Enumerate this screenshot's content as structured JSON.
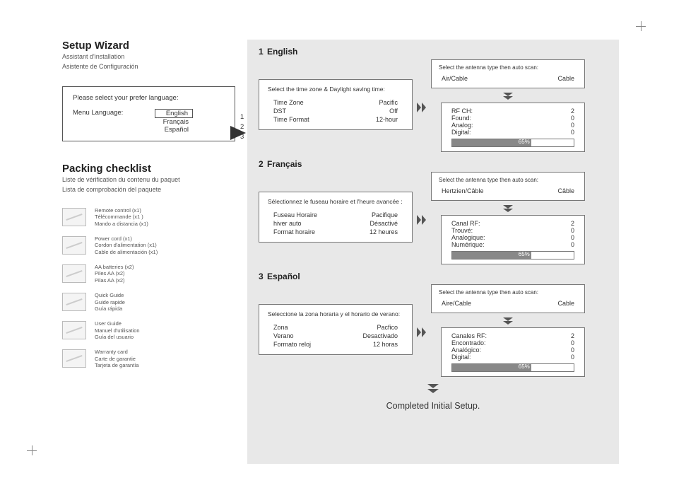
{
  "setup": {
    "title": "Setup Wizard",
    "sub1": "Assistant d'installation",
    "sub2": "Asistente de Configuración",
    "lang_prompt": "Please select your prefer language:",
    "menu_label": "Menu Language:",
    "opt_en": "English",
    "opt_fr": "Français",
    "opt_es": "Español",
    "n1": "1",
    "n2": "2",
    "n3": "3"
  },
  "packing": {
    "title": "Packing checklist",
    "sub1": "Liste de vérification du contenu du paquet",
    "sub2": "Lista de comprobación del paquete",
    "items": [
      {
        "l1": "Remote control (x1)",
        "l2": "Télécommande (x1 )",
        "l3": "Mando a distancia (x1)"
      },
      {
        "l1": "Power cord (x1)",
        "l2": "Cordon d'alimentation (x1)",
        "l3": "Cable de alimentación (x1)"
      },
      {
        "l1": "AA batteries (x2)",
        "l2": "Piles AA (x2)",
        "l3": "Pilas AA (x2)"
      },
      {
        "l1": "Quick Guide",
        "l2": "Guide rapide",
        "l3": "Guía rápida"
      },
      {
        "l1": "User Guide",
        "l2": "Manuel d'utilisation",
        "l3": "Guía del usuario"
      },
      {
        "l1": "Warranty card",
        "l2": "Carte de garantie",
        "l3": "Tarjeta de garantía"
      }
    ]
  },
  "sections": {
    "en": {
      "num": "1",
      "head": "English",
      "tz_title": "Select the time zone & Daylight saving time:",
      "r1l": "Time Zone",
      "r1v": "Pacific",
      "r2l": "DST",
      "r2v": "Off",
      "r3l": "Time Format",
      "r3v": "12-hour",
      "ant_title": "Select the antenna type then auto scan:",
      "ant_l": "Air/Cable",
      "ant_v": "Cable",
      "s1l": "RF CH:",
      "s1v": "2",
      "s2l": "Found:",
      "s2v": "0",
      "s3l": "Analog:",
      "s3v": "0",
      "s4l": "Digital:",
      "s4v": "0",
      "pct": "65%"
    },
    "fr": {
      "num": "2",
      "head": "Français",
      "tz_title": "Sélectionnez le fuseau horaire et l'heure avancée :",
      "r1l": "Fuseau Horaire",
      "r1v": "Pacifique",
      "r2l": "hiver auto",
      "r2v": "Désactivé",
      "r3l": "Format horaire",
      "r3v": "12 heures",
      "ant_title": "Select the antenna type then auto scan:",
      "ant_l": "Hertzien/Câble",
      "ant_v": "Câble",
      "s1l": "Canal RF:",
      "s1v": "2",
      "s2l": "Trouvé:",
      "s2v": "0",
      "s3l": "Analogique:",
      "s3v": "0",
      "s4l": "Numérique:",
      "s4v": "0",
      "pct": "65%"
    },
    "es": {
      "num": "3",
      "head": "Español",
      "tz_title": "Seleccione la zona horaria y el horario de verano:",
      "r1l": "Zona",
      "r1v": "Pacfico",
      "r2l": "Verano",
      "r2v": "Desactivado",
      "r3l": "Formato reloj",
      "r3v": "12 horas",
      "ant_title": "Select the antenna type then auto scan:",
      "ant_l": "Aire/Cable",
      "ant_v": "Cable",
      "s1l": "Canales RF:",
      "s1v": "2",
      "s2l": "Encontrado:",
      "s2v": "0",
      "s3l": "Analógico:",
      "s3v": "0",
      "s4l": "Digital:",
      "s4v": "0",
      "pct": "65%"
    }
  },
  "completed": "Completed Initial Setup."
}
